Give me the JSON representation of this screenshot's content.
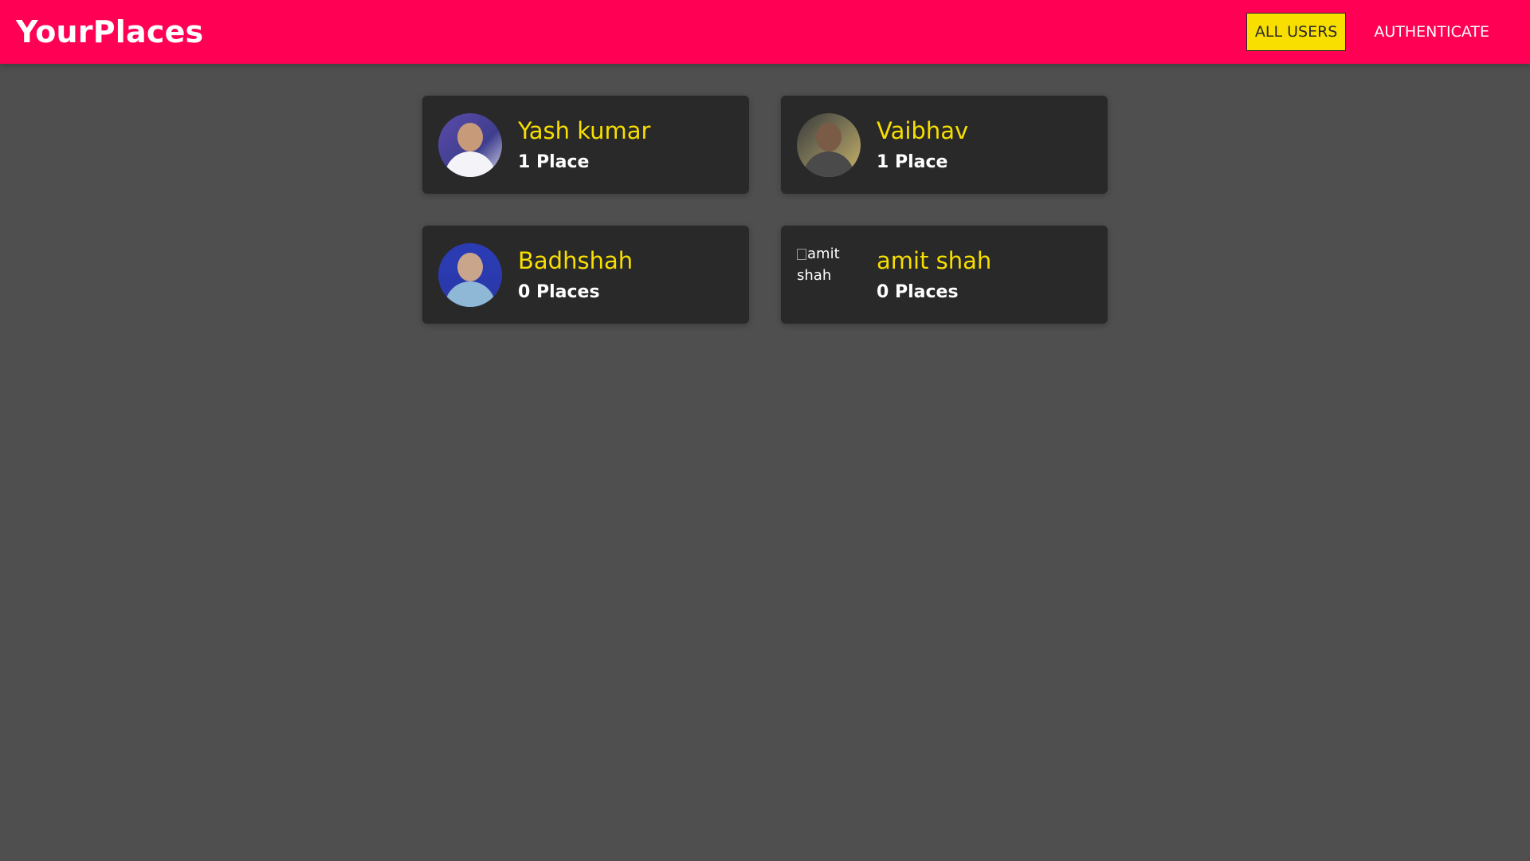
{
  "header": {
    "brand": "YourPlaces",
    "color": "#ff0055",
    "nav": [
      {
        "label": "ALL USERS",
        "active": true
      },
      {
        "label": "AUTHENTICATE",
        "active": false
      }
    ]
  },
  "users": [
    {
      "name": "Yash kumar",
      "places": "1 Place",
      "avatar_alt": "Yash kumar"
    },
    {
      "name": "Vaibhav",
      "places": "1 Place",
      "avatar_alt": "Vaibhav"
    },
    {
      "name": "Badhshah",
      "places": "0 Places",
      "avatar_alt": "Badhshah"
    },
    {
      "name": "amit shah",
      "places": "0 Places",
      "avatar_alt": "amit shah",
      "image_broken": true
    }
  ],
  "colors": {
    "background": "#4f4f4f",
    "card": "#292929",
    "accent_yellow": "#f8df00"
  }
}
